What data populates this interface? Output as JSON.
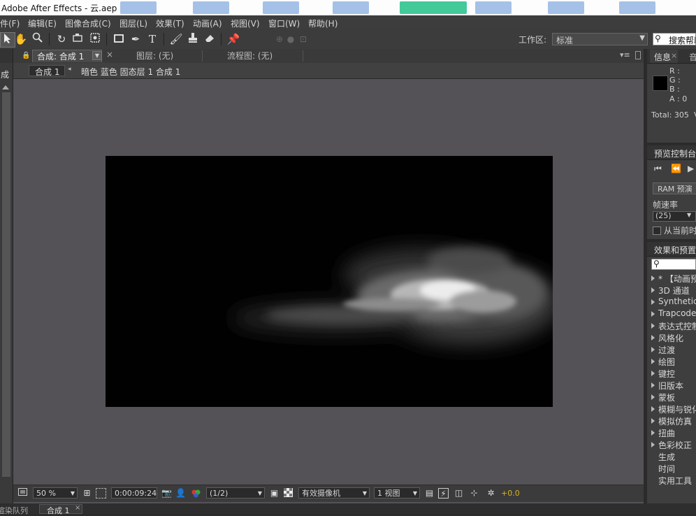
{
  "window": {
    "title": "Adobe After Effects - 云.aep"
  },
  "menu": [
    "件(F)",
    "编辑(E)",
    "图像合成(C)",
    "图层(L)",
    "效果(T)",
    "动画(A)",
    "视图(V)",
    "窗口(W)",
    "帮助(H)"
  ],
  "toolbar": {
    "workspace_label": "工作区:",
    "workspace_value": "标准",
    "search_placeholder": "搜索帮助"
  },
  "left_strip": {
    "label": "成"
  },
  "comp_panel": {
    "tab_comp": "合成: 合成 1",
    "tab_layer": "图层: (无)",
    "tab_flow": "流程图: (无)",
    "breadcrumb_comp": "合成 1",
    "breadcrumb_path": "暗色 蓝色 固态层 1 合成 1",
    "zoom": "50 %",
    "timecode": "0:00:09:24",
    "resolution": "(1/2)",
    "camera": "有效摄像机",
    "views": "1 视图",
    "exposure": "+0.0"
  },
  "info_panel": {
    "tab_info": "信息",
    "tab_audio": "音",
    "r": "R :",
    "g": "G :",
    "b": "B :",
    "a": "A : 0",
    "total": "Total: 305",
    "total_suffix": "V"
  },
  "preview_panel": {
    "title": "预览控制台",
    "ram_button": "RAM 预演",
    "framerate_label": "帧速率",
    "framerate_value": "(25)",
    "from_current": "从当前时"
  },
  "effects_panel": {
    "title": "效果和预置",
    "items": [
      "* 【动画预",
      "3D 通道",
      "Synthetic A",
      "Trapcode",
      "表达式控制",
      "风格化",
      "过渡",
      "绘图",
      "键控",
      "旧版本",
      "蒙板",
      "模糊与锐化",
      "模拟仿真",
      "扭曲",
      "色彩校正",
      "生成",
      "时间",
      "实用工具"
    ]
  },
  "bottom_tabs": {
    "render_queue": "渲染队列",
    "comp_tab": "合成 1"
  },
  "colors": {
    "accent_yellow": "#d9b320",
    "panel_bg": "#555257"
  }
}
